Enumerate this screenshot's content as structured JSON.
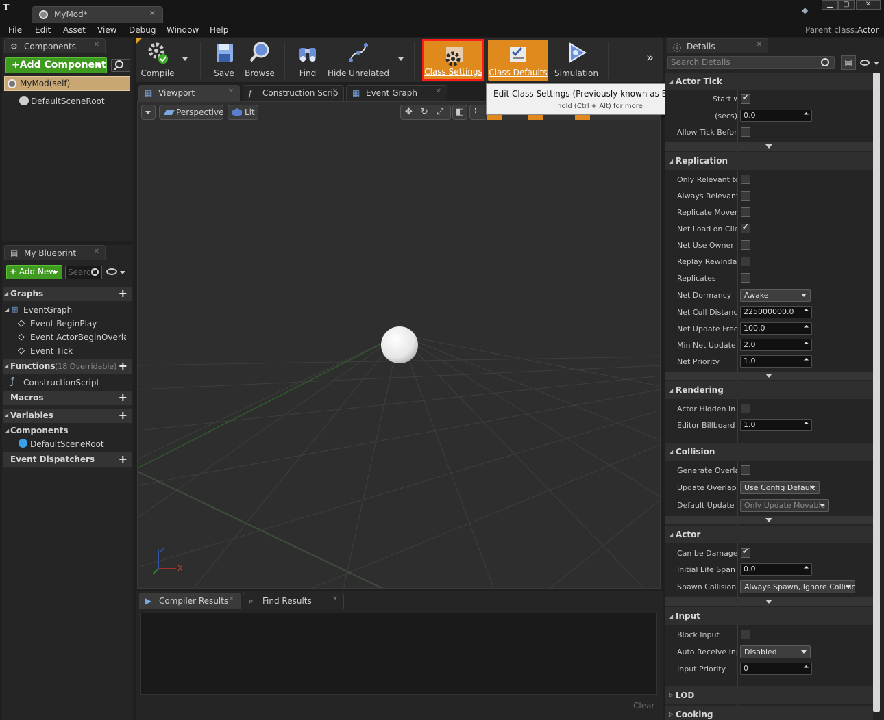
{
  "window": {
    "doc_tab": "MyMod*",
    "close_glyph": "✕",
    "min_glyph": "▁",
    "max_glyph": "▢",
    "win_close_glyph": "✕"
  },
  "menu": [
    "File",
    "Edit",
    "Asset",
    "View",
    "Debug",
    "Window",
    "Help"
  ],
  "parent_class": {
    "label": "Parent class:",
    "value": "Actor"
  },
  "components_panel": {
    "tab": "Components",
    "add_button": "+Add Component",
    "items": [
      "MyMod(self)",
      "DefaultSceneRoot"
    ]
  },
  "my_blueprint": {
    "tab": "My Blueprint",
    "add_new": "Add New",
    "search_placeholder": "Search",
    "graphs": "Graphs",
    "event_graph": "EventGraph",
    "events": [
      "Event BeginPlay",
      "Event ActorBeginOverlap",
      "Event Tick"
    ],
    "functions": "Functions",
    "functions_note": "(18 Overridable)",
    "construction_script": "ConstructionScript",
    "macros": "Macros",
    "variables": "Variables",
    "components": "Components",
    "component_item": "DefaultSceneRoot",
    "event_dispatchers": "Event Dispatchers"
  },
  "toolbar": {
    "compile": "Compile",
    "save": "Save",
    "browse": "Browse",
    "find": "Find",
    "hide_unrelated": "Hide Unrelated",
    "class_settings": "Class Settings",
    "class_defaults": "Class Defaults",
    "simulation": "Simulation"
  },
  "editor_tabs": [
    "Viewport",
    "Construction Scrip",
    "Event Graph"
  ],
  "viewport": {
    "perspective": "Perspective",
    "lit": "Lit",
    "axis_x": "X",
    "axis_z": "Z"
  },
  "tooltip": {
    "title": "Edit Class Settings (Previously known as Blueprint Props)",
    "hint": "hold (Ctrl + Alt) for more"
  },
  "bottom_tabs": [
    "Compiler Results",
    "Find Results"
  ],
  "clear_button": "Clear",
  "details": {
    "tab": "Details",
    "search_placeholder": "Search Details",
    "actor_tick": {
      "title": "Actor Tick",
      "rows": [
        {
          "label": "Start with Tick Enabled",
          "checked": true
        },
        {
          "label": "Tick Interval (secs)",
          "value": "0.0"
        },
        {
          "label": "Allow Tick Before Begin Play",
          "checked": false
        }
      ]
    },
    "replication": {
      "title": "Replication",
      "only_relevant": "Only Relevant to Owner",
      "always_relevant": "Always Relevant",
      "replicate_movement": "Replicate Movement",
      "net_load": "Net Load on Client",
      "net_use_owner": "Net Use Owner Relevancy",
      "replay_rewindable": "Replay Rewindable",
      "replicates": "Replicates",
      "net_dormancy": "Net Dormancy",
      "net_dormancy_value": "Awake",
      "net_cull": "Net Cull Distance Squared",
      "net_cull_value": "225000000.0",
      "net_update_freq": "Net Update Frequency",
      "net_update_freq_value": "100.0",
      "min_net_update": "Min Net Update Frequency",
      "min_net_update_value": "2.0",
      "net_priority": "Net Priority",
      "net_priority_value": "1.0"
    },
    "rendering": {
      "title": "Rendering",
      "hidden": "Actor Hidden In Game",
      "billboard": "Editor Billboard Scale",
      "billboard_value": "1.0"
    },
    "collision": {
      "title": "Collision",
      "gen_overlap": "Generate Overlap Events During Level Streaming",
      "update_overlaps": "Update Overlaps Method During Level Streaming",
      "update_overlaps_value": "Use Config Default",
      "default_update": "Default Update Overlaps Method During Level Streaming",
      "default_update_value": "Only Update Movable"
    },
    "actor": {
      "title": "Actor",
      "can_damage": "Can be Damaged",
      "life_span": "Initial Life Span",
      "life_span_value": "0.0",
      "spawn_collision": "Spawn Collision Handling Method",
      "spawn_collision_value": "Always Spawn, Ignore Collisions"
    },
    "input": {
      "title": "Input",
      "block": "Block Input",
      "auto_receive": "Auto Receive Input",
      "auto_receive_value": "Disabled",
      "priority": "Input Priority",
      "priority_value": "0"
    },
    "lod": "LOD",
    "cooking": "Cooking"
  },
  "colors": {
    "accent_orange": "#e08a1e",
    "highlight_red": "#ff1a1a",
    "green": "#3f9b1f"
  }
}
